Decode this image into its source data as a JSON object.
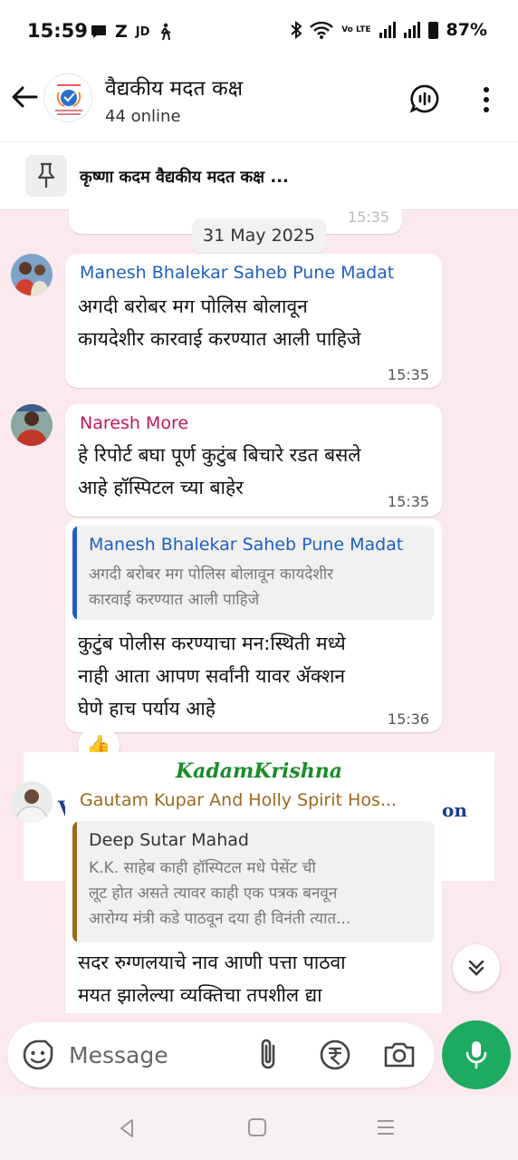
{
  "status_bar": {
    "time": "15:59",
    "left_indicators": [
      "Z",
      "JD"
    ],
    "volte": "Vo LTE",
    "battery": "87%"
  },
  "header": {
    "title": "वैद्यकीय मदत कक्ष",
    "subtitle": "44 online"
  },
  "pinned": {
    "text": "कृष्णा कदम वैद्यकीय मदत कक्ष ..."
  },
  "chat": {
    "previous_time": "15:35",
    "date_chip": "31 May 2025",
    "messages": [
      {
        "sender": "Manesh Bhalekar Saheb Pune Madat",
        "sender_color": "#1f5fbf",
        "lines": [
          "अगदी बरोबर मग पोलिस बोलावून",
          "कायदेशीर कारवाई करण्यात आली पाहिजे"
        ],
        "time": "15:35"
      },
      {
        "sender": "Naresh More",
        "sender_color": "#c2185b",
        "lines": [
          "हे रिपोर्ट बघा पूर्ण कुटुंब बिचारे रडत बसले",
          "आहे हॉस्पिटल च्या बाहेर"
        ],
        "time": "15:35"
      },
      {
        "quote_name": "Manesh Bhalekar Saheb Pune Madat",
        "quote_color": "#1f5fbf",
        "quote_lines": [
          "अगदी बरोबर मग पोलिस बोलावून कायदेशीर",
          "कारवाई करण्यात आली पाहिजे"
        ],
        "lines": [
          "कुटुंब पोलीस करण्याचा मन:स्थिती मध्ये",
          "नाही आता आपण सर्वांनी यावर ॲक्शन",
          "घेणे हाच पर्याय आहे"
        ],
        "time": "15:36",
        "reaction": "👍"
      },
      {
        "sender": "Gautam Kupar And Holly Spirit Hos...",
        "sender_color": "#9a6a1e",
        "quote_name": "Deep Sutar Mahad",
        "quote_color": "#9a6a1e",
        "quote_lines": [
          "K.K. साहेब काही हॉस्पिटल मधे पेसेंट ची",
          "लूट होत असते त्यावर काही एक पत्रक बनवून",
          "आरोग्य मंत्री कडे पाठवून दया ही विनंती त्यात..."
        ],
        "lines": [
          "सदर  रुग्णलयाचे नाव आणी पत्ता पाठवा",
          "मयत झालेल्या व्यक्तिचा तपशील द्या"
        ]
      }
    ],
    "media": {
      "word": "KadamKrishna",
      "frag_left": "V",
      "frag_right": "on"
    }
  },
  "composer": {
    "placeholder": "Message"
  },
  "colors": {
    "accent_green": "#1daa61",
    "chat_bg": "#fce9ee"
  }
}
